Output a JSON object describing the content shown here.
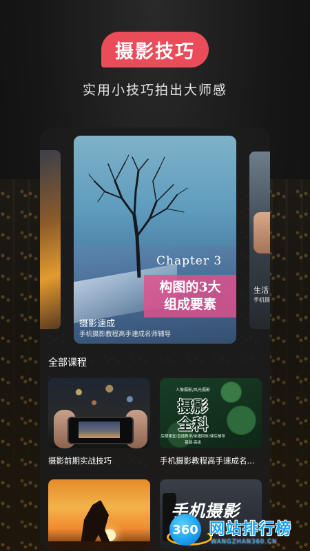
{
  "header": {
    "title": "摄影技巧",
    "subtitle": "实用小技巧拍出大师感",
    "accent_color": "#ea4d59"
  },
  "carousel": {
    "featured": {
      "chapter_label": "Chapter 3",
      "headline_line1": "构图的3大",
      "headline_line2": "组成要素",
      "title": "摄影速成",
      "description": "手机摄影教程高手速成名师辅导"
    },
    "right_peek": {
      "title": "生活",
      "description": "手机摄"
    }
  },
  "courses": {
    "section_title": "全部课程",
    "items": [
      {
        "label": "摄影前期实战技巧"
      },
      {
        "label": "手机摄影教程高手速成名...",
        "thumb_tag": "人像摄影/风光摄影",
        "thumb_big1": "摄影",
        "thumb_big2": "全科",
        "thumb_small1": "后期课堂/直播教学/录播回放/课后辅导",
        "thumb_small2": "基础·高级"
      },
      {
        "label": ""
      },
      {
        "label": "",
        "thumb_text": "手机摄影"
      }
    ]
  },
  "watermark": {
    "badge": "360",
    "text": "网站排行榜",
    "url": "WANGZHAN360.CN"
  }
}
